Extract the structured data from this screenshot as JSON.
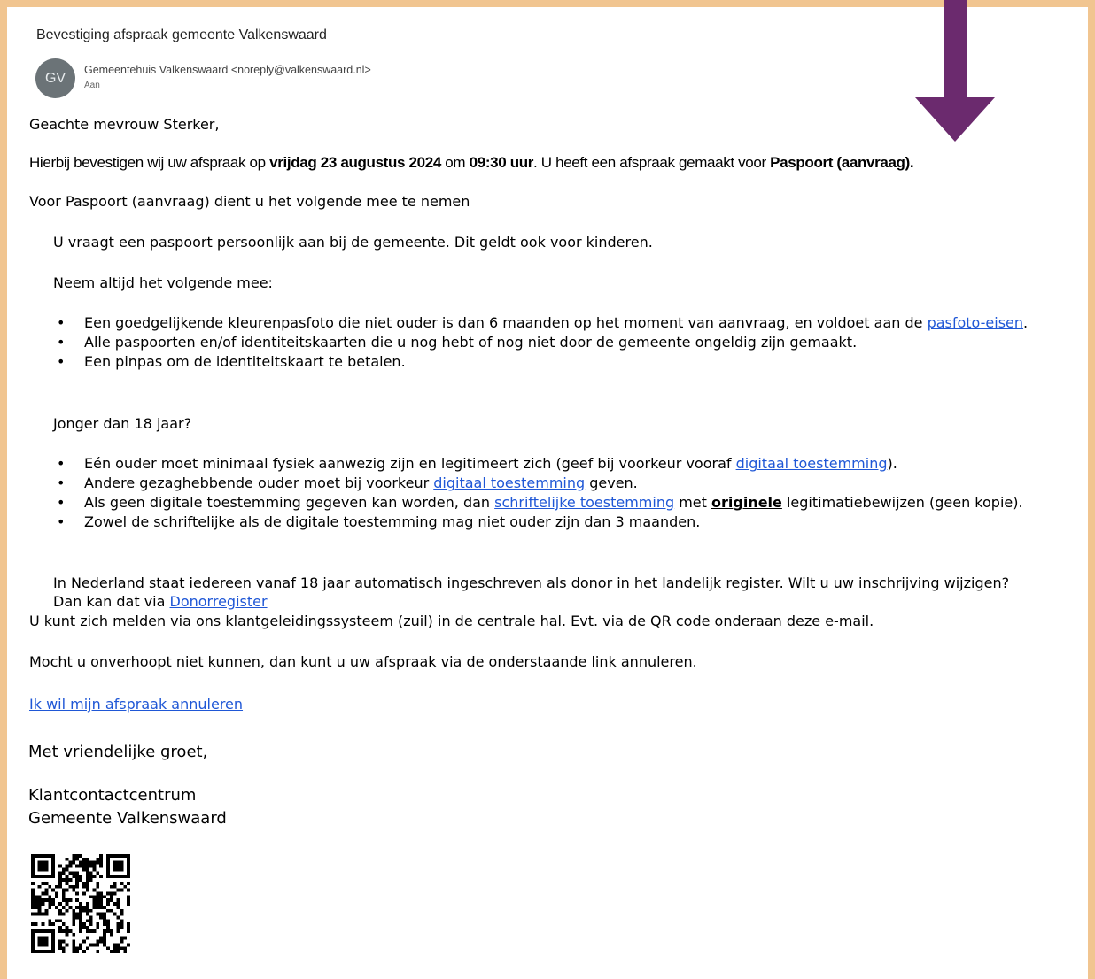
{
  "email": {
    "subject": "Bevestiging afspraak gemeente Valkenswaard",
    "avatar_initials": "GV",
    "sender": "Gemeentehuis Valkenswaard <noreply@valkenswaard.nl>",
    "to_label": "Aan"
  },
  "body": {
    "greeting": "Geachte mevrouw Sterker,",
    "confirm_pre": "Hierbij bevestigen wij uw afspraak op ",
    "confirm_date": "vrijdag 23 augustus 2024",
    "confirm_mid": " om ",
    "confirm_time": "09:30 uur",
    "confirm_post": ". U heeft een afspraak gemaakt voor ",
    "confirm_product": "Paspoort (aanvraag).",
    "bring_intro": "Voor Paspoort (aanvraag) dient u het volgende mee te nemen",
    "personal_line": "U vraagt een paspoort persoonlijk aan bij de gemeente. Dit geldt ook voor kinderen.",
    "always_bring": "Neem altijd het volgende mee:",
    "list1": {
      "item1_text": "Een goedgelijkende kleurenpasfoto die niet ouder is dan 6 maanden op het moment van aanvraag, en voldoet aan de ",
      "item1_link": "pasfoto-eisen",
      "item1_end": ".",
      "item2": "Alle paspoorten en/of identiteitskaarten die u nog hebt of nog niet door de gemeente ongeldig zijn gemaakt.",
      "item3": "Een pinpas om de identiteitskaart te betalen."
    },
    "under18": "Jonger dan 18 jaar?",
    "list2": {
      "item1_text": "Eén ouder moet minimaal fysiek aanwezig zijn en legitimeert zich (geef bij voorkeur vooraf ",
      "item1_link": "digitaal toestemming",
      "item1_end": ").",
      "item2_text": "Andere gezaghebbende ouder moet bij voorkeur ",
      "item2_link": "digitaal toestemming",
      "item2_end": " geven.",
      "item3_text": "Als geen digitale toestemming gegeven kan worden, dan ",
      "item3_link": "schriftelijke toestemming",
      "item3_mid": " met ",
      "item3_bold": "originele",
      "item3_end": " legitimatiebewijzen (geen kopie).",
      "item4": "Zowel de schriftelijke als de digitale toestemming mag niet ouder zijn dan 3 maanden."
    },
    "donor_text": "In Nederland staat iedereen vanaf 18 jaar automatisch ingeschreven als donor in het landelijk register. Wilt u uw inschrijving wijzigen?",
    "donor_text2": "Dan kan dat via ",
    "donor_link": "Donorregister",
    "checkin": "U kunt zich melden via ons klantgeleidingssysteem (zuil) in de centrale hal. Evt. via de QR code onderaan deze e-mail.",
    "cancel_intro": "Mocht u onverhoopt niet kunnen, dan kunt u uw afspraak via de onderstaande link annuleren.",
    "cancel_link": "Ik wil mijn afspraak annuleren",
    "regards": "Met vriendelijke groet,",
    "sig1": "Klantcontactcentrum",
    "sig2": "Gemeente Valkenswaard"
  },
  "colors": {
    "frame": "#f1c590",
    "arrow": "#6b2a6e",
    "link": "#1f57d6",
    "avatar": "#6b7377"
  },
  "icons": {
    "arrow": "down-arrow-icon",
    "qr": "qr-code-icon"
  }
}
